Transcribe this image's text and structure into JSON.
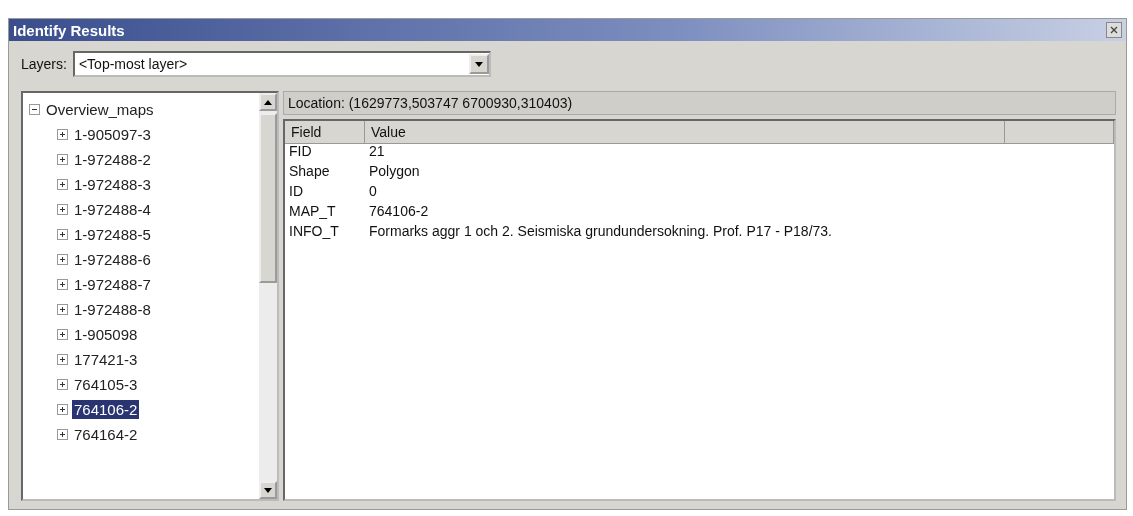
{
  "window": {
    "title": "Identify Results"
  },
  "layers": {
    "label": "Layers:",
    "value": "<Top-most layer>"
  },
  "tree": [
    {
      "label": "Overview_maps",
      "expanded": true,
      "selected": false,
      "children": [
        {
          "label": "1-905097-3",
          "expanded": false,
          "selected": false
        },
        {
          "label": "1-972488-2",
          "expanded": false,
          "selected": false
        },
        {
          "label": "1-972488-3",
          "expanded": false,
          "selected": false
        },
        {
          "label": "1-972488-4",
          "expanded": false,
          "selected": false
        },
        {
          "label": "1-972488-5",
          "expanded": false,
          "selected": false
        },
        {
          "label": "1-972488-6",
          "expanded": false,
          "selected": false
        },
        {
          "label": "1-972488-7",
          "expanded": false,
          "selected": false
        },
        {
          "label": "1-972488-8",
          "expanded": false,
          "selected": false
        },
        {
          "label": "1-905098",
          "expanded": false,
          "selected": false
        },
        {
          "label": "177421-3",
          "expanded": false,
          "selected": false
        },
        {
          "label": "764105-3",
          "expanded": false,
          "selected": false
        },
        {
          "label": "764106-2",
          "expanded": false,
          "selected": true
        },
        {
          "label": "764164-2",
          "expanded": false,
          "selected": false
        }
      ]
    }
  ],
  "location": "Location: (1629773,503747 6700930,310403)",
  "table": {
    "columns": [
      "Field",
      "Value"
    ],
    "rows": [
      {
        "field": "FID",
        "value": "21"
      },
      {
        "field": "Shape",
        "value": "Polygon"
      },
      {
        "field": "ID",
        "value": "0"
      },
      {
        "field": "MAP_T",
        "value": "764106-2"
      },
      {
        "field": "INFO_T",
        "value": "Formarks aggr 1 och 2. Seismiska grundundersokning. Prof. P17 - P18/73."
      }
    ]
  }
}
